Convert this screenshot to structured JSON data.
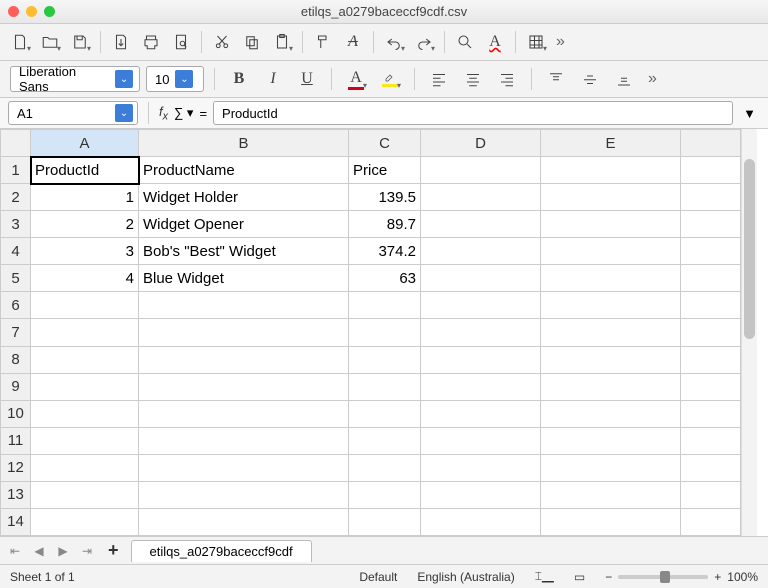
{
  "window": {
    "title": "etilqs_a0279baceccf9cdf.csv"
  },
  "font": {
    "name": "Liberation Sans",
    "size": "10"
  },
  "cellref": "A1",
  "formula": "ProductId",
  "columns": [
    "A",
    "B",
    "C",
    "D",
    "E"
  ],
  "headers": {
    "A": "ProductId",
    "B": "ProductName",
    "C": "Price"
  },
  "rows": [
    {
      "A": "1",
      "B": "Widget Holder",
      "C": "139.5"
    },
    {
      "A": "2",
      "B": "Widget Opener",
      "C": "89.7"
    },
    {
      "A": "3",
      "B": "Bob's \"Best\" Widget",
      "C": "374.2"
    },
    {
      "A": "4",
      "B": "Blue Widget",
      "C": "63"
    }
  ],
  "sheet_tab": "etilqs_a0279baceccf9cdf",
  "status": {
    "sheet": "Sheet 1 of 1",
    "style": "Default",
    "lang": "English (Australia)",
    "zoom": "100%"
  }
}
